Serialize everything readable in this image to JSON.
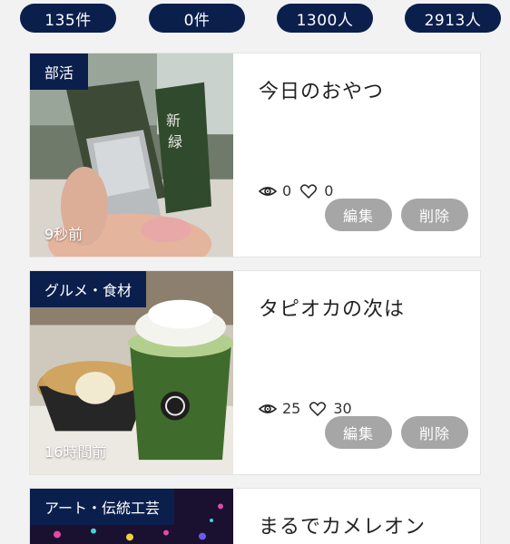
{
  "stats": [
    "135件",
    "0件",
    "1300人",
    "2913人"
  ],
  "posts": [
    {
      "category": "部活",
      "time": "9秒前",
      "title": "今日のおやつ",
      "views": "0",
      "likes": "0",
      "edit_label": "編集",
      "delete_label": "削除"
    },
    {
      "category": "グルメ・食材",
      "time": "16時間前",
      "title": "タピオカの次は",
      "views": "25",
      "likes": "30",
      "edit_label": "編集",
      "delete_label": "削除"
    },
    {
      "category": "アート・伝統工芸",
      "title": "まるでカメレオン"
    }
  ],
  "icons": {
    "views": "eye-icon",
    "likes": "heart-icon"
  },
  "colors": {
    "navy": "#0b1f4d",
    "button_gray": "#a6a6a6",
    "background": "#f2f2f2"
  }
}
